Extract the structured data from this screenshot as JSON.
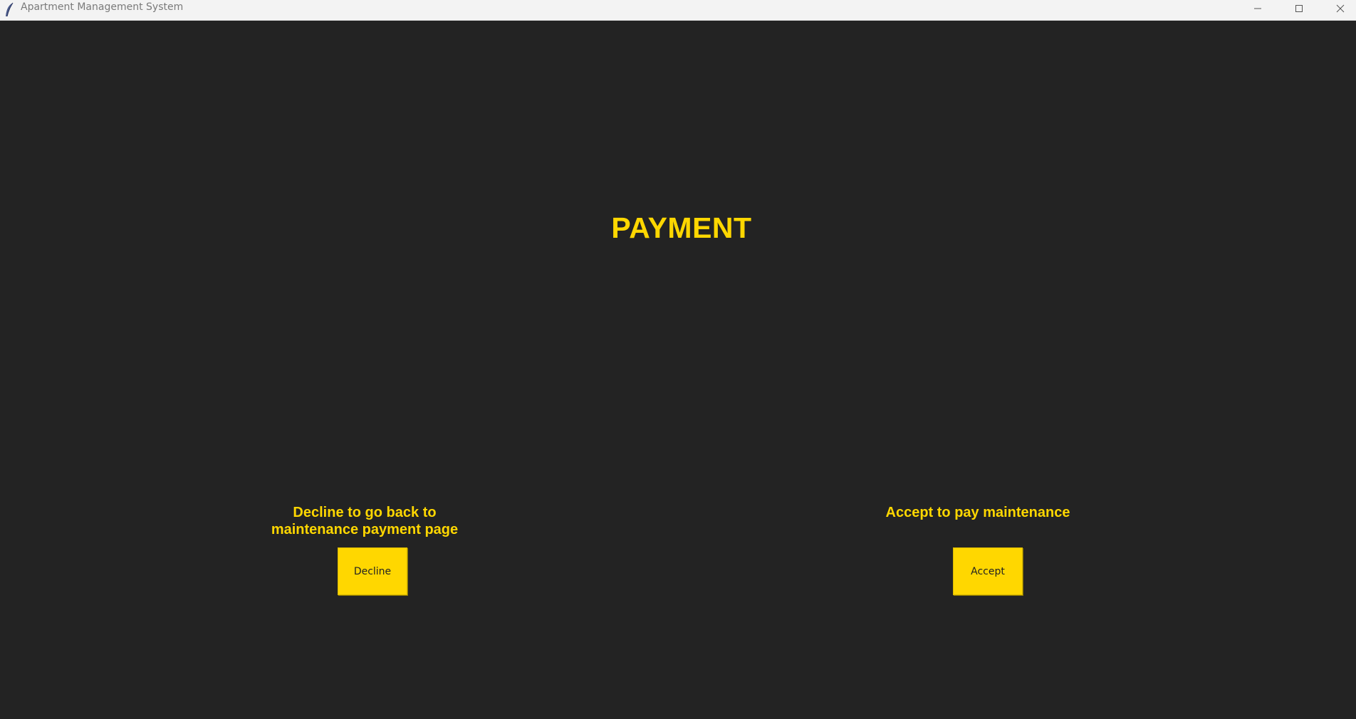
{
  "window": {
    "title": "Apartment Management System",
    "icons": {
      "app": "feather-icon",
      "minimize": "minimize-icon",
      "maximize": "maximize-icon",
      "close": "close-icon"
    }
  },
  "page": {
    "title": "PAYMENT",
    "decline_hint": "Decline to go back to\nmaintenance payment page",
    "accept_hint": "Accept to pay maintenance",
    "decline_label": "Decline",
    "accept_label": "Accept"
  },
  "colors": {
    "background": "#232323",
    "accent": "#ffd700",
    "titlebar": "#f3f3f3"
  }
}
